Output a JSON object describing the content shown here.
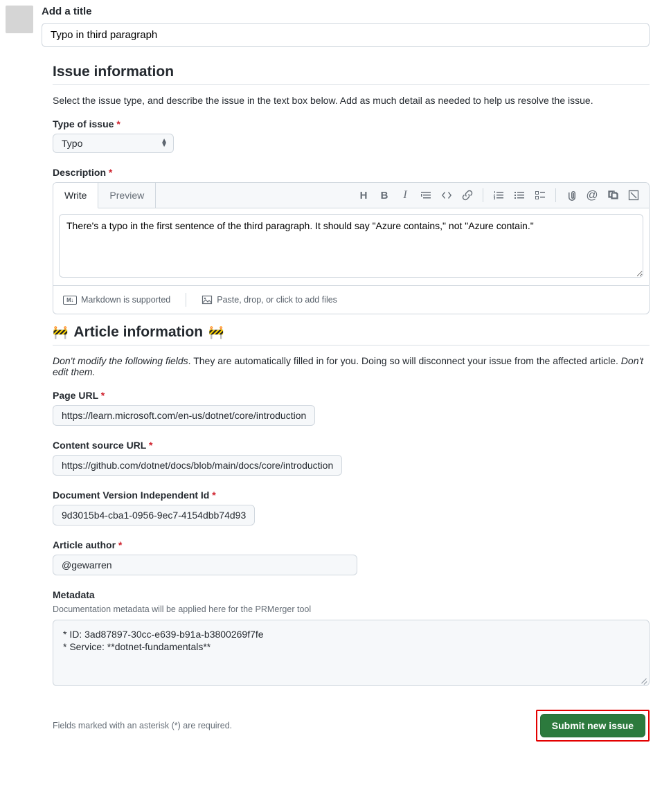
{
  "title_section": {
    "label": "Add a title",
    "value": "Typo in third paragraph"
  },
  "issue_info": {
    "heading": "Issue information",
    "description": "Select the issue type, and describe the issue in the text box below. Add as much detail as needed to help us resolve the issue.",
    "type_label": "Type of issue",
    "type_value": "Typo",
    "desc_label": "Description"
  },
  "editor": {
    "tabs": {
      "write": "Write",
      "preview": "Preview"
    },
    "content": "There's a typo in the first sentence of the third paragraph. It should say \"Azure contains,\" not \"Azure contain.\"",
    "markdown_support": "Markdown is supported",
    "attach_hint": "Paste, drop, or click to add files"
  },
  "article_info": {
    "heading": "Article information",
    "emoji": "🚧",
    "warn_bold": "Don't modify the following fields",
    "warn_rest": ". They are automatically filled in for you. Doing so will disconnect your issue from the affected article. ",
    "warn_tail": "Don't edit them.",
    "fields": {
      "page_url": {
        "label": "Page URL",
        "value": "https://learn.microsoft.com/en-us/dotnet/core/introduction"
      },
      "content_source": {
        "label": "Content source URL",
        "value": "https://github.com/dotnet/docs/blob/main/docs/core/introduction"
      },
      "doc_version_id": {
        "label": "Document Version Independent Id",
        "value": "9d3015b4-cba1-0956-9ec7-4154dbb74d93"
      },
      "author": {
        "label": "Article author",
        "value": "@gewarren"
      }
    },
    "metadata": {
      "label": "Metadata",
      "sub": "Documentation metadata will be applied here for the PRMerger tool",
      "line1": "* ID: 3ad87897-30cc-e639-b91a-b3800269f7fe",
      "line2": "* Service: **dotnet-fundamentals**"
    }
  },
  "footer": {
    "asterisk_note": "Fields marked with an asterisk (*) are required.",
    "submit": "Submit new issue"
  }
}
